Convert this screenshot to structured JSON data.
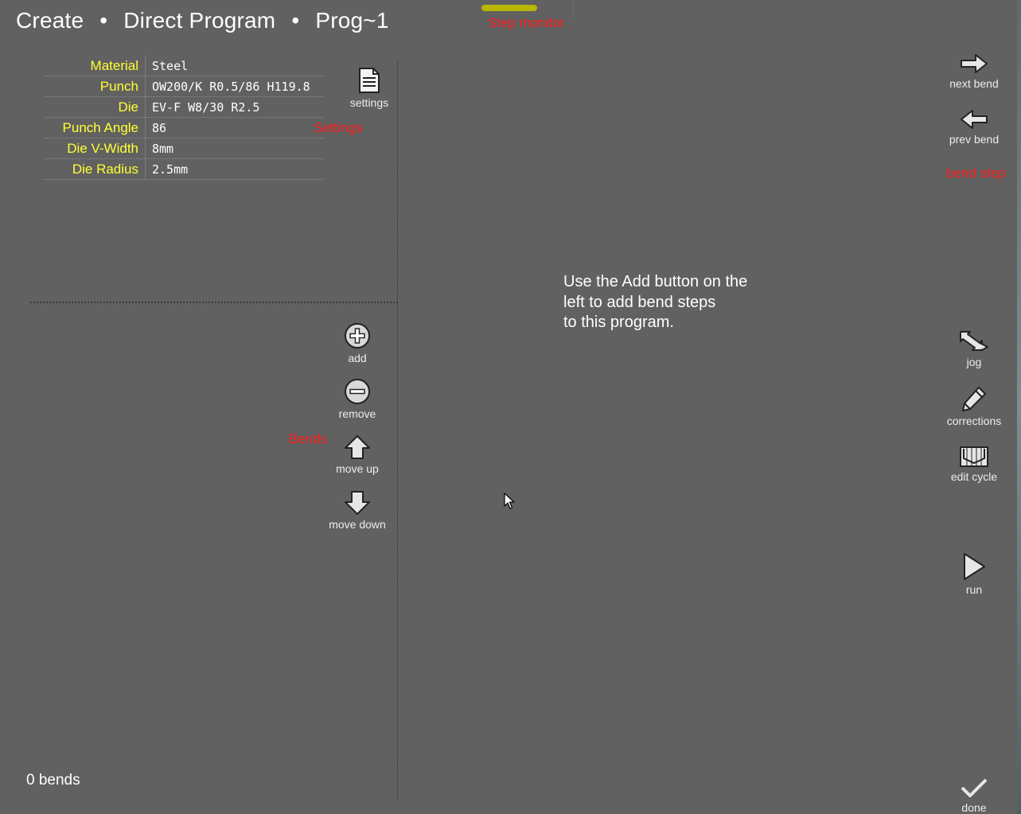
{
  "header": {
    "crumbs": [
      "Create",
      "Direct Program",
      "Prog~1"
    ],
    "separator": "•"
  },
  "step_monitor": {
    "label": "Step monitor",
    "bar_color": "#b8b800"
  },
  "annotations": {
    "settings": "Settings",
    "bends": "Bends",
    "bend_step": "bend step"
  },
  "properties": [
    {
      "key": "Material",
      "value": "Steel"
    },
    {
      "key": "Punch",
      "value": "OW200/K R0.5/86 H119.8"
    },
    {
      "key": "Die",
      "value": "EV-F W8/30 R2.5"
    },
    {
      "key": "Punch Angle",
      "value": "86"
    },
    {
      "key": "Die V-Width",
      "value": "8mm"
    },
    {
      "key": "Die Radius",
      "value": "2.5mm"
    }
  ],
  "tools": {
    "settings": "settings",
    "add": "add",
    "remove": "remove",
    "move_up": "move up",
    "move_down": "move down",
    "next_bend": "next bend",
    "prev_bend": "prev bend",
    "jog": "jog",
    "corrections": "corrections",
    "edit_cycle": "edit cycle",
    "run": "run",
    "done": "done"
  },
  "hint": [
    "Use the Add button on the",
    "left to add bend steps",
    "to this program."
  ],
  "status": {
    "bend_count": "0 bends"
  },
  "colors": {
    "background": "#616161",
    "label": "#ffff33",
    "annotation": "#ff1a1a"
  }
}
